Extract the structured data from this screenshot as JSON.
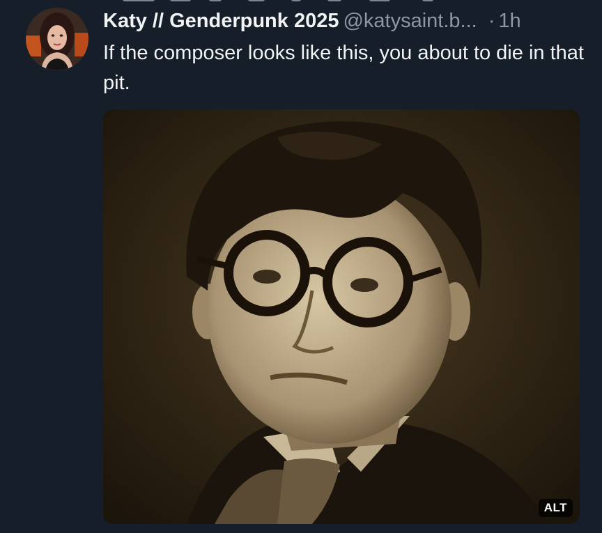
{
  "post": {
    "author_display_name": "Katy // Genderpunk 2025",
    "author_handle": "@katysaint.b...",
    "separator": "·",
    "time_ago": "1h",
    "text": "If the composer looks like this, you about to die in that pit.",
    "avatar_icon": "profile-photo",
    "image": {
      "alt_badge": "ALT",
      "description_icon": "sepia-portrait-photo"
    }
  },
  "colors": {
    "background": "#161e2a",
    "text_primary": "#f1f3f5",
    "text_secondary": "#8d97a5",
    "photo_sepia": "#2b2112"
  }
}
